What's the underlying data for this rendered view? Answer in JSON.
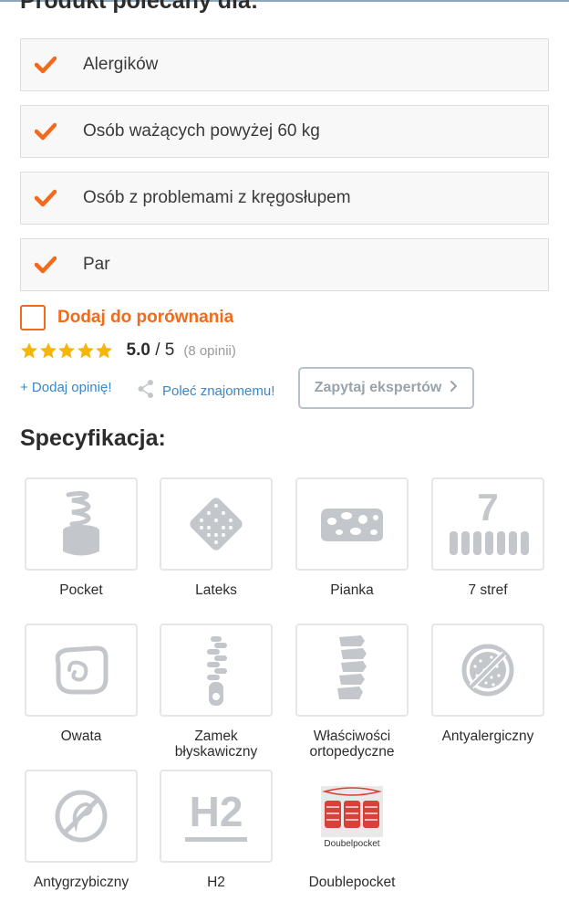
{
  "recommended": {
    "heading": "Produkt polecany dla:",
    "items": [
      {
        "label": "Alergików"
      },
      {
        "label": "Osób ważących powyżej 60 kg"
      },
      {
        "label": "Osób z problemami z kręgosłupem"
      },
      {
        "label": "Par"
      }
    ]
  },
  "compare": {
    "label": "Dodaj do porównania",
    "checked": false
  },
  "rating": {
    "stars": 5,
    "score": "5.0",
    "out_of": " / 5",
    "count": "(8 opinii)"
  },
  "actions": {
    "add_review": "+ Dodaj opinię!",
    "recommend": "Poleć znajomemu!",
    "ask_experts": "Zapytaj ekspertów"
  },
  "specs": {
    "heading": "Specyfikacja:",
    "items": [
      {
        "caption": "Pocket",
        "icon": "spring-icon"
      },
      {
        "caption": "Lateks",
        "icon": "latex-icon"
      },
      {
        "caption": "Pianka",
        "icon": "foam-icon"
      },
      {
        "caption": "7 stref",
        "icon": "seven-zones-icon",
        "icon_text": "7"
      },
      {
        "caption": "Owata",
        "icon": "wadding-icon"
      },
      {
        "caption": "Zamek błyskawiczny",
        "icon": "zipper-icon"
      },
      {
        "caption": "Właściwości ortopedyczne",
        "icon": "spine-icon"
      },
      {
        "caption": "Antyalergiczny",
        "icon": "anti-allergy-icon"
      },
      {
        "caption": "Antygrzybiczny",
        "icon": "anti-fungal-icon"
      },
      {
        "caption": "H2",
        "icon": "hardness-h2-icon",
        "icon_text": "H2"
      },
      {
        "caption": "Doublepocket",
        "icon": "doublepocket-icon",
        "icon_text": "Doubelpocket"
      }
    ]
  },
  "colors": {
    "accent": "#f26a1b",
    "star": "#f5b50a",
    "link": "#3a86c8",
    "icon_gray": "#c3c7cb"
  }
}
